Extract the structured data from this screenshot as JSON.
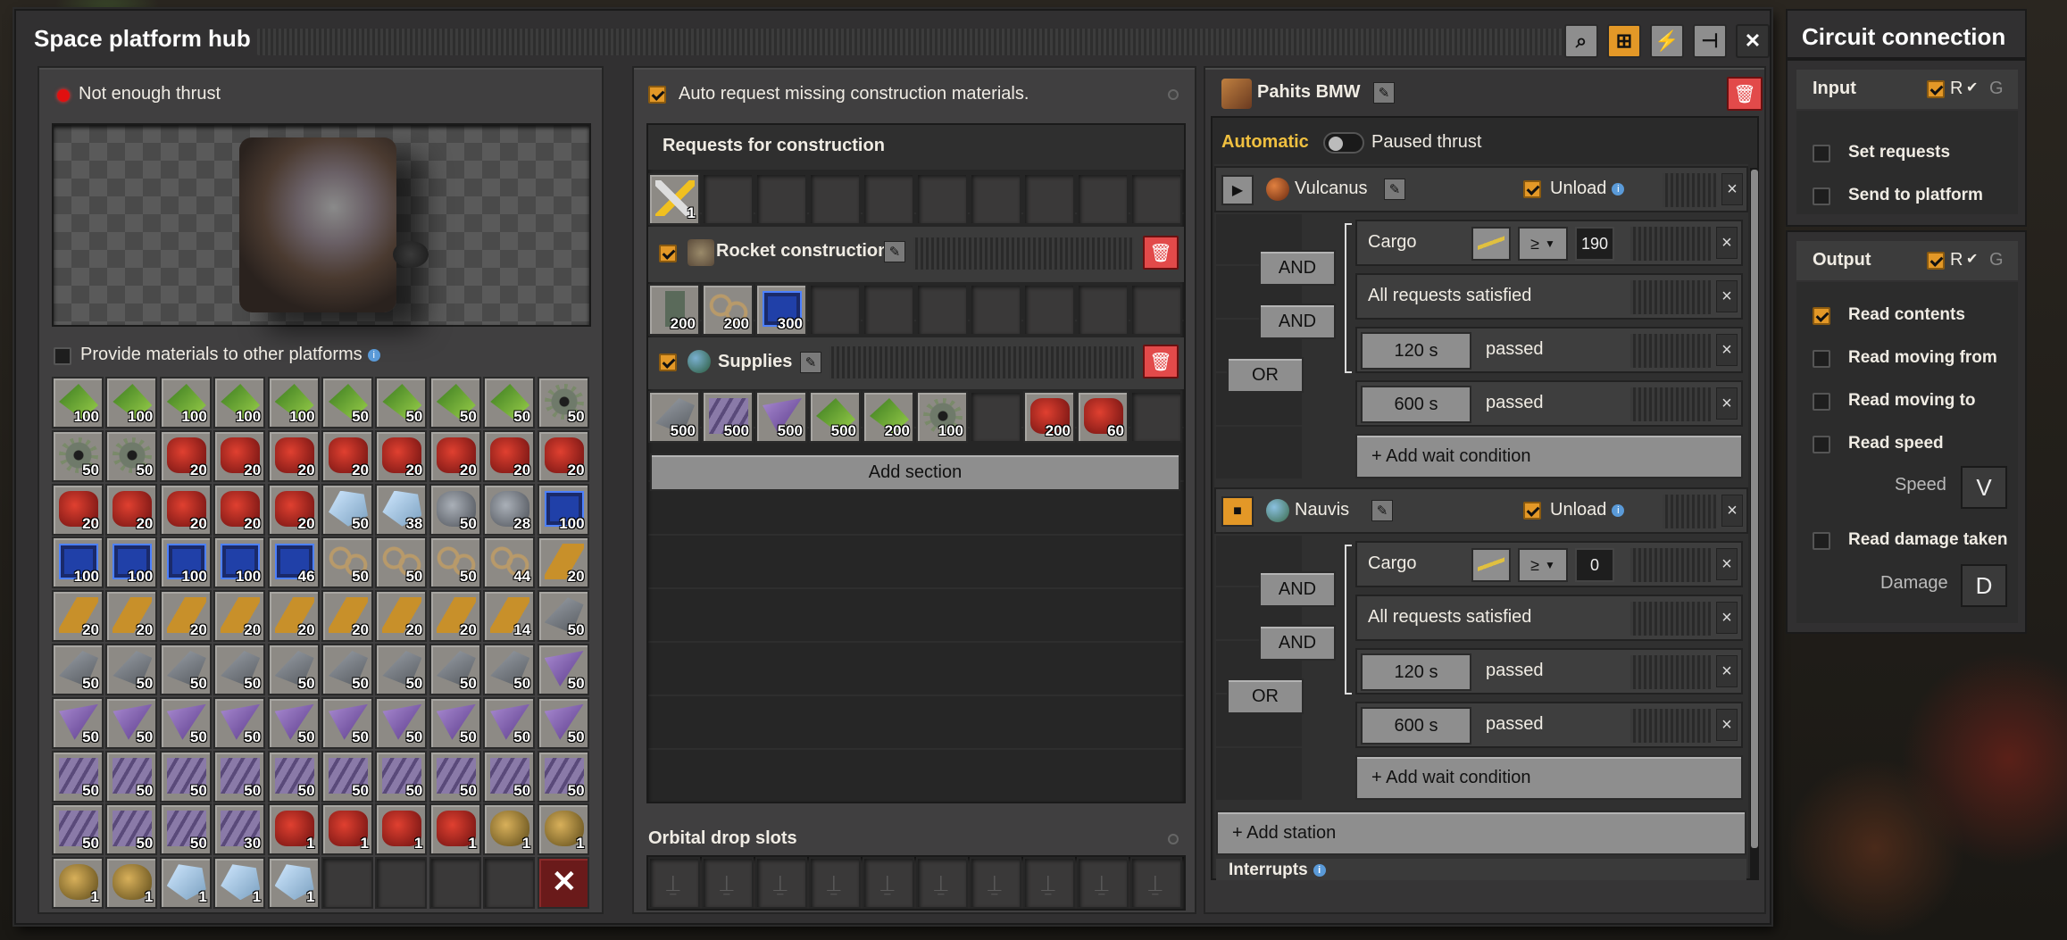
{
  "hub": {
    "title": "Space platform hub",
    "status": "Not enough thrust",
    "provide_label": "Provide materials to other platforms",
    "inventory": [
      {
        "icon": "green",
        "count": "100"
      },
      {
        "icon": "green",
        "count": "100"
      },
      {
        "icon": "green",
        "count": "100"
      },
      {
        "icon": "green",
        "count": "100"
      },
      {
        "icon": "green",
        "count": "100"
      },
      {
        "icon": "green",
        "count": "50"
      },
      {
        "icon": "green",
        "count": "50"
      },
      {
        "icon": "green",
        "count": "50"
      },
      {
        "icon": "green",
        "count": "50"
      },
      {
        "icon": "gear",
        "count": "50"
      },
      {
        "icon": "gear",
        "count": "50"
      },
      {
        "icon": "gear",
        "count": "50"
      },
      {
        "icon": "red",
        "count": "20"
      },
      {
        "icon": "red",
        "count": "20"
      },
      {
        "icon": "red",
        "count": "20"
      },
      {
        "icon": "red",
        "count": "20"
      },
      {
        "icon": "red",
        "count": "20"
      },
      {
        "icon": "red",
        "count": "20"
      },
      {
        "icon": "red",
        "count": "20"
      },
      {
        "icon": "red",
        "count": "20"
      },
      {
        "icon": "red",
        "count": "20"
      },
      {
        "icon": "red",
        "count": "20"
      },
      {
        "icon": "red",
        "count": "20"
      },
      {
        "icon": "red",
        "count": "20"
      },
      {
        "icon": "red",
        "count": "20"
      },
      {
        "icon": "ice",
        "count": "50"
      },
      {
        "icon": "ice",
        "count": "38"
      },
      {
        "icon": "rock",
        "count": "50"
      },
      {
        "icon": "rock",
        "count": "28"
      },
      {
        "icon": "blue",
        "count": "100"
      },
      {
        "icon": "blue",
        "count": "100"
      },
      {
        "icon": "blue",
        "count": "100"
      },
      {
        "icon": "blue",
        "count": "100"
      },
      {
        "icon": "blue",
        "count": "100"
      },
      {
        "icon": "blue",
        "count": "46"
      },
      {
        "icon": "chain",
        "count": "50"
      },
      {
        "icon": "chain",
        "count": "50"
      },
      {
        "icon": "chain",
        "count": "50"
      },
      {
        "icon": "chain",
        "count": "44"
      },
      {
        "icon": "tube",
        "count": "20"
      },
      {
        "icon": "tube",
        "count": "20"
      },
      {
        "icon": "tube",
        "count": "20"
      },
      {
        "icon": "tube",
        "count": "20"
      },
      {
        "icon": "tube",
        "count": "20"
      },
      {
        "icon": "tube",
        "count": "20"
      },
      {
        "icon": "tube",
        "count": "20"
      },
      {
        "icon": "tube",
        "count": "20"
      },
      {
        "icon": "tube",
        "count": "20"
      },
      {
        "icon": "tube",
        "count": "14"
      },
      {
        "icon": "wing",
        "count": "50"
      },
      {
        "icon": "wing",
        "count": "50"
      },
      {
        "icon": "wing",
        "count": "50"
      },
      {
        "icon": "wing",
        "count": "50"
      },
      {
        "icon": "wing",
        "count": "50"
      },
      {
        "icon": "wing",
        "count": "50"
      },
      {
        "icon": "wing",
        "count": "50"
      },
      {
        "icon": "wing",
        "count": "50"
      },
      {
        "icon": "wing",
        "count": "50"
      },
      {
        "icon": "wing",
        "count": "50"
      },
      {
        "icon": "tri",
        "count": "50"
      },
      {
        "icon": "tri",
        "count": "50"
      },
      {
        "icon": "tri",
        "count": "50"
      },
      {
        "icon": "tri",
        "count": "50"
      },
      {
        "icon": "tri",
        "count": "50"
      },
      {
        "icon": "tri",
        "count": "50"
      },
      {
        "icon": "tri",
        "count": "50"
      },
      {
        "icon": "tri",
        "count": "50"
      },
      {
        "icon": "tri",
        "count": "50"
      },
      {
        "icon": "tri",
        "count": "50"
      },
      {
        "icon": "tri",
        "count": "50"
      },
      {
        "icon": "plate",
        "count": "50"
      },
      {
        "icon": "plate",
        "count": "50"
      },
      {
        "icon": "plate",
        "count": "50"
      },
      {
        "icon": "plate",
        "count": "50"
      },
      {
        "icon": "plate",
        "count": "50"
      },
      {
        "icon": "plate",
        "count": "50"
      },
      {
        "icon": "plate",
        "count": "50"
      },
      {
        "icon": "plate",
        "count": "50"
      },
      {
        "icon": "plate",
        "count": "50"
      },
      {
        "icon": "plate",
        "count": "50"
      },
      {
        "icon": "plate",
        "count": "50"
      },
      {
        "icon": "plate",
        "count": "50"
      },
      {
        "icon": "plate",
        "count": "50"
      },
      {
        "icon": "plate",
        "count": "30"
      },
      {
        "icon": "red",
        "count": "1"
      },
      {
        "icon": "red",
        "count": "1"
      },
      {
        "icon": "red",
        "count": "1"
      },
      {
        "icon": "red",
        "count": "1"
      },
      {
        "icon": "gold",
        "count": "1"
      },
      {
        "icon": "gold",
        "count": "1"
      },
      {
        "icon": "gold",
        "count": "1"
      },
      {
        "icon": "gold",
        "count": "1"
      },
      {
        "icon": "ice",
        "count": "1"
      },
      {
        "icon": "ice",
        "count": "1"
      },
      {
        "icon": "ice",
        "count": "1"
      },
      {
        "icon": "",
        "count": ""
      },
      {
        "icon": "",
        "count": ""
      },
      {
        "icon": "",
        "count": ""
      },
      {
        "icon": "",
        "count": ""
      },
      {
        "icon": "trash",
        "count": ""
      }
    ]
  },
  "requests": {
    "auto_request_label": "Auto request missing construction materials.",
    "header": "Requests for construction",
    "construction_slot": {
      "icon": "tool",
      "count": "1"
    },
    "sections": [
      {
        "name": "Rocket construction",
        "items": [
          {
            "icon": "cell",
            "count": "200"
          },
          {
            "icon": "chain",
            "count": "200"
          },
          {
            "icon": "blue",
            "count": "300"
          }
        ]
      },
      {
        "name": "Supplies",
        "items": [
          {
            "icon": "wing",
            "count": "500"
          },
          {
            "icon": "plate",
            "count": "500"
          },
          {
            "icon": "tri",
            "count": "500"
          },
          {
            "icon": "green",
            "count": "500"
          },
          {
            "icon": "green",
            "count": "200"
          },
          {
            "icon": "gear",
            "count": "100"
          },
          {
            "icon": "",
            "count": ""
          },
          {
            "icon": "red",
            "count": "200"
          },
          {
            "icon": "red",
            "count": "60"
          }
        ]
      }
    ],
    "add_section": "Add section",
    "orbital_drop": "Orbital drop slots"
  },
  "schedule": {
    "platform_name": "Pahits BMW",
    "automatic": "Automatic",
    "paused": "Paused thrust",
    "stations": [
      {
        "name": "Vulcanus",
        "unload": "Unload",
        "cargo": "Cargo",
        "op": "≥",
        "cargo_val": "190",
        "all_req": "All requests satisfied",
        "t1": "120 s",
        "t2": "600 s",
        "passed": "passed",
        "add_wait": "+ Add wait condition"
      },
      {
        "name": "Nauvis",
        "unload": "Unload",
        "cargo": "Cargo",
        "op": "≥",
        "cargo_val": "0",
        "all_req": "All requests satisfied",
        "t1": "120 s",
        "t2": "600 s",
        "passed": "passed",
        "add_wait": "+ Add wait condition"
      }
    ],
    "and": "AND",
    "or": "OR",
    "add_station": "+ Add station",
    "interrupts": "Interrupts"
  },
  "circuit": {
    "title": "Circuit connection",
    "input": "Input",
    "output": "Output",
    "r": "R",
    "g": "G",
    "set_requests": "Set requests",
    "send_to_platform": "Send to platform",
    "read_contents": "Read contents",
    "read_moving_from": "Read moving from",
    "read_moving_to": "Read moving to",
    "read_speed": "Read speed",
    "speed": "Speed",
    "speed_signal": "V",
    "read_damage": "Read damage taken",
    "damage": "Damage",
    "damage_signal": "D"
  },
  "colors": {
    "accent": "#e39827",
    "delete": "#e24a4a",
    "status_red": "#e01010"
  }
}
